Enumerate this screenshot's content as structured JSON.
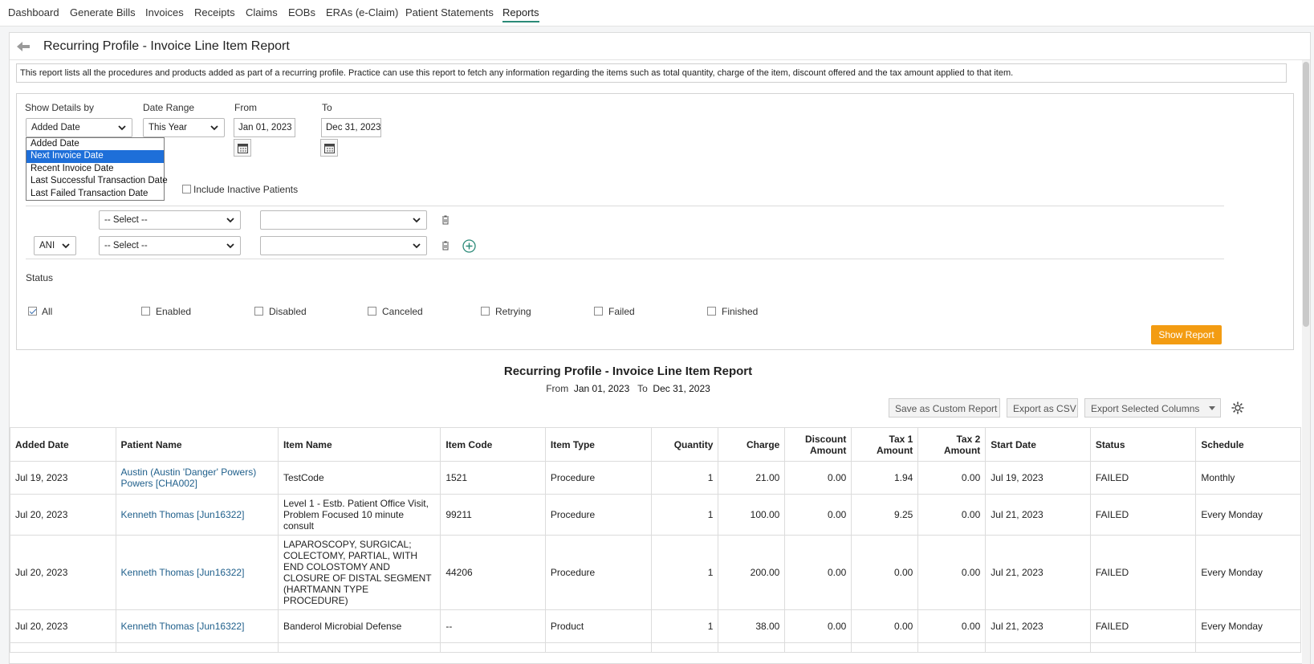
{
  "nav": {
    "items": [
      {
        "label": "Dashboard"
      },
      {
        "label": "Generate Bills"
      },
      {
        "label": "Invoices"
      },
      {
        "label": "Receipts"
      },
      {
        "label": "Claims"
      },
      {
        "label": "EOBs"
      },
      {
        "label": "ERAs (e-Claim)"
      },
      {
        "label": "Patient Statements"
      },
      {
        "label": "Reports"
      }
    ],
    "active": "Reports",
    "accent_color": "#2b8a78"
  },
  "page": {
    "title": "Recurring Profile - Invoice Line Item Report",
    "description": "This report lists all the procedures and products added as part of a recurring profile. Practice can use this report to fetch any information regarding the items such as total quantity, charge of the item, discount offered and the tax amount applied to that item."
  },
  "filters": {
    "show_details_label": "Show Details by",
    "show_details_value": "Added Date",
    "show_details_options": [
      "Added Date",
      "Next Invoice Date",
      "Recent Invoice Date",
      "Last Successful Transaction Date",
      "Last Failed Transaction Date"
    ],
    "show_details_highlighted": "Next Invoice Date",
    "date_range_label": "Date Range",
    "date_range_value": "This Year",
    "from_label": "From",
    "from_value": "Jan 01, 2023",
    "to_label": "To",
    "to_value": "Dec 31, 2023",
    "include_inactive_label": "Include Inactive Patients",
    "include_inactive_checked": false,
    "criteria": [
      {
        "field": "-- Select --",
        "value": ""
      },
      {
        "operator": "ANI",
        "field": "-- Select --",
        "value": ""
      }
    ],
    "status_label": "Status",
    "status_options": [
      {
        "label": "All",
        "checked": true
      },
      {
        "label": "Enabled",
        "checked": false
      },
      {
        "label": "Disabled",
        "checked": false
      },
      {
        "label": "Canceled",
        "checked": false
      },
      {
        "label": "Retrying",
        "checked": false
      },
      {
        "label": "Failed",
        "checked": false
      },
      {
        "label": "Finished",
        "checked": false
      }
    ],
    "show_report_label": "Show Report",
    "show_report_color": "#f39c12"
  },
  "report": {
    "title": "Recurring Profile - Invoice Line Item Report",
    "range_from_label": "From",
    "range_from": "Jan 01, 2023",
    "range_to_label": "To",
    "range_to": "Dec 31, 2023",
    "actions": {
      "save_custom": "Save as Custom Report",
      "export_csv": "Export as CSV",
      "export_selected": "Export Selected Columns"
    },
    "columns": [
      "Added Date",
      "Patient Name",
      "Item Name",
      "Item Code",
      "Item Type",
      "Quantity",
      "Charge",
      "Discount Amount",
      "Tax 1 Amount",
      "Tax 2 Amount",
      "Start Date",
      "Status",
      "Schedule"
    ],
    "rows": [
      [
        "Jul 19, 2023",
        "Austin (Austin 'Danger' Powers) Powers [CHA002]",
        "TestCode",
        "1521",
        "Procedure",
        "1",
        "21.00",
        "0.00",
        "1.94",
        "0.00",
        "Jul 19, 2023",
        "FAILED",
        "Monthly"
      ],
      [
        "Jul 20, 2023",
        "Kenneth Thomas [Jun16322]",
        "Level 1 - Estb. Patient Office Visit, Problem Focused 10 minute consult",
        "99211",
        "Procedure",
        "1",
        "100.00",
        "0.00",
        "9.25",
        "0.00",
        "Jul 21, 2023",
        "FAILED",
        "Every Monday"
      ],
      [
        "Jul 20, 2023",
        "Kenneth Thomas [Jun16322]",
        "LAPAROSCOPY, SURGICAL; COLECTOMY, PARTIAL, WITH END COLOSTOMY AND CLOSURE OF DISTAL SEGMENT (HARTMANN TYPE PROCEDURE)",
        "44206",
        "Procedure",
        "1",
        "200.00",
        "0.00",
        "0.00",
        "0.00",
        "Jul 21, 2023",
        "FAILED",
        "Every Monday"
      ],
      [
        "Jul 20, 2023",
        "Kenneth Thomas [Jun16322]",
        "Banderol Microbial Defense",
        "--",
        "Product",
        "1",
        "38.00",
        "0.00",
        "0.00",
        "0.00",
        "Jul 21, 2023",
        "FAILED",
        "Every Monday"
      ]
    ]
  }
}
